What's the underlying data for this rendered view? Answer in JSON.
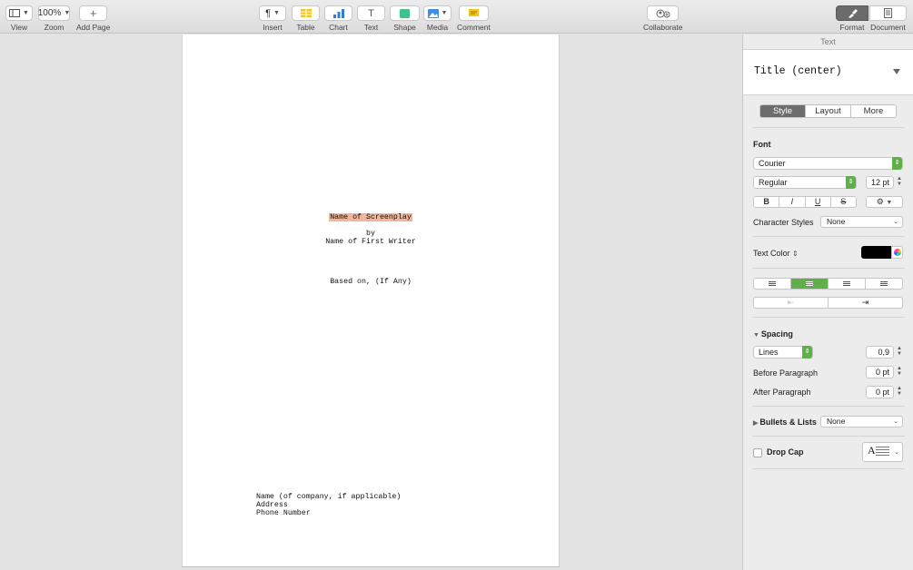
{
  "toolbar": {
    "view": {
      "label": "View",
      "icon": "sidebar-icon"
    },
    "zoom": {
      "label": "Zoom",
      "value": "100%"
    },
    "add_page": {
      "label": "Add Page",
      "icon": "plus-icon"
    },
    "insert": {
      "label": "Insert",
      "icon": "pilcrow-icon",
      "glyph": "¶"
    },
    "table": {
      "label": "Table",
      "icon": "table-icon"
    },
    "chart": {
      "label": "Chart",
      "icon": "chart-icon"
    },
    "text": {
      "label": "Text",
      "icon": "text-icon",
      "glyph": "T"
    },
    "shape": {
      "label": "Shape",
      "icon": "shape-icon"
    },
    "media": {
      "label": "Media",
      "icon": "media-icon"
    },
    "comment": {
      "label": "Comment",
      "icon": "comment-icon"
    },
    "collaborate": {
      "label": "Collaborate",
      "icon": "collaborate-icon"
    },
    "format": {
      "label": "Format",
      "icon": "paintbrush-icon",
      "active": true
    },
    "document": {
      "label": "Document",
      "icon": "document-icon"
    }
  },
  "document": {
    "title": "Name of Screenplay",
    "by": "by",
    "writer": "Name of First Writer",
    "based_on": "Based on, (If Any)",
    "company": "Name (of company, if applicable)",
    "address": "Address",
    "phone": "Phone Number"
  },
  "inspector": {
    "header": "Text",
    "paragraph_style": "Title (center)",
    "tabs": [
      "Style",
      "Layout",
      "More"
    ],
    "active_tab": "Style",
    "font_label": "Font",
    "font_family": "Courier",
    "font_style": "Regular",
    "font_size": "12 pt",
    "bold": "B",
    "italic": "I",
    "underline": "U",
    "strike": "S",
    "character_styles_label": "Character Styles",
    "character_styles_value": "None",
    "text_color_label": "Text Color",
    "text_color": "#000000",
    "alignment_selected": "center",
    "spacing_label": "Spacing",
    "spacing_mode": "Lines",
    "spacing_value": "0,9",
    "before_paragraph_label": "Before Paragraph",
    "before_paragraph_value": "0 pt",
    "after_paragraph_label": "After Paragraph",
    "after_paragraph_value": "0 pt",
    "bullets_label": "Bullets & Lists",
    "bullets_value": "None",
    "drop_cap_label": "Drop Cap"
  },
  "colors": {
    "accent_green": "#5fb04b",
    "highlight": "#f3b49a"
  }
}
